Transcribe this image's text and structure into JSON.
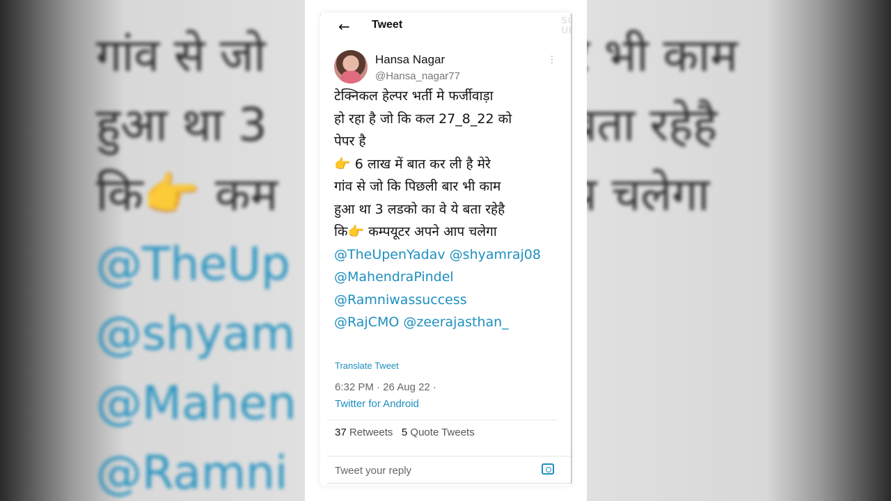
{
  "background": {
    "left_lines": [
      "गांव से जो",
      "हुआ था 3",
      "कि👉 कम",
      "@TheUp",
      "@shyam",
      "@Mahen",
      "@Ramni"
    ],
    "right_lines": [
      "र भी काम",
      "बता रहेहै",
      "प चलेगा"
    ]
  },
  "header": {
    "back_icon": "←",
    "title": "Tweet",
    "watermark": "SO\nUP"
  },
  "author": {
    "name": "Hansa Nagar",
    "handle": "@Hansa_nagar77",
    "more_icon": "⋮"
  },
  "tweet": {
    "lines": [
      "टेक्निकल हेल्पर भर्ती मे फर्जीवाड़ा",
      "हो रहा है जो कि कल 27_8_22 को",
      "पेपर है",
      "👉 6 लाख में बात कर ली है मेरे",
      "गांव से जो कि पिछली बार भी काम",
      "हुआ था 3 लडको का वे ये बता रहेहै",
      "कि👉 कम्पयूटर अपने आप चलेगा"
    ],
    "mentions": [
      "@TheUpenYadav",
      "@shyamraj08",
      "@MahendraPindel",
      "@Ramniwassuccess",
      "@RajCMO @zeerajasthan_"
    ],
    "translate": "Translate Tweet",
    "timestamp": "6:32 PM · 26 Aug 22 ·",
    "source": "Twitter for Android"
  },
  "stats": {
    "retweets_count": "37",
    "retweets_label": "Retweets",
    "quotes_count": "5",
    "quotes_label": "Quote Tweets"
  },
  "reply": {
    "placeholder": "Tweet your reply",
    "camera_icon": "camera-icon"
  },
  "colors": {
    "link": "#1d8fbf",
    "text": "#111111",
    "muted": "#666666"
  }
}
